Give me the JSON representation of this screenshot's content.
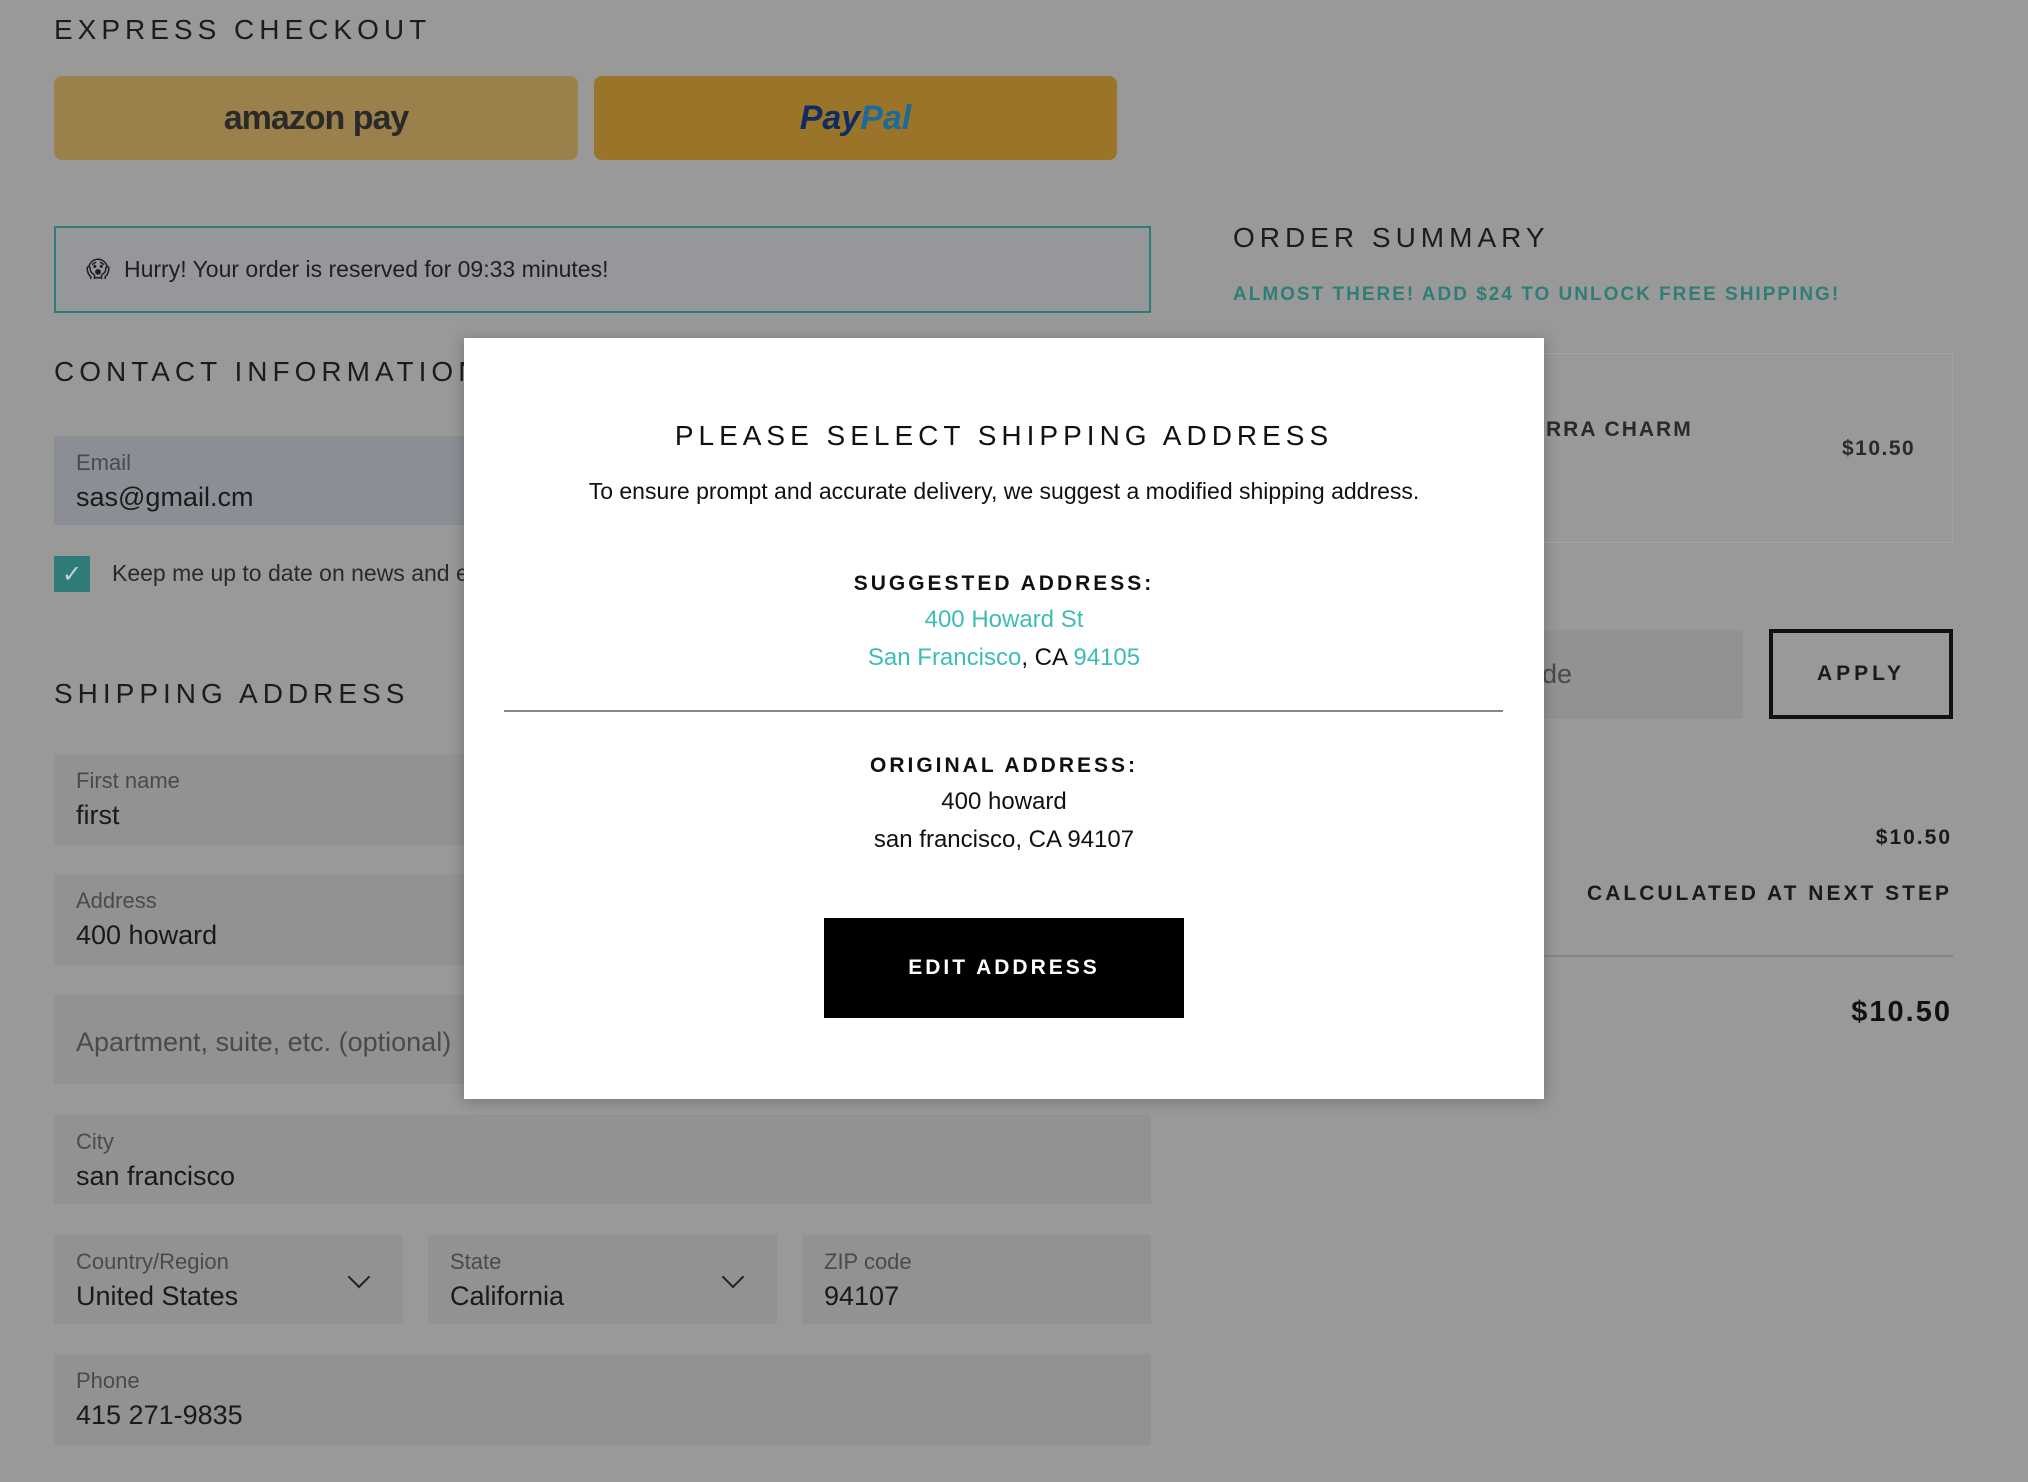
{
  "express": {
    "title": "EXPRESS CHECKOUT",
    "amazon_label": "amazon pay",
    "paypal_label_1": "Pay",
    "paypal_label_2": "Pal"
  },
  "timer": {
    "icon": "screaming-face-emoji",
    "text": "Hurry! Your order is reserved for 09:33 minutes!"
  },
  "contact": {
    "title": "CONTACT INFORMATION",
    "email_label": "Email",
    "email_value": "sas@gmail.cm",
    "newsletter_checked": true,
    "newsletter_label": "Keep me up to date on news and e"
  },
  "shipping": {
    "title": "SHIPPING ADDRESS",
    "first_name_label": "First name",
    "first_name_value": "first",
    "address_label": "Address",
    "address_value": "400 howard",
    "apt_placeholder": "Apartment, suite, etc. (optional)",
    "city_label": "City",
    "city_value": "san francisco",
    "country_label": "Country/Region",
    "country_value": "United States",
    "state_label": "State",
    "state_value": "California",
    "zip_label": "ZIP code",
    "zip_value": "94107",
    "phone_label": "Phone",
    "phone_value": "415 271-9835"
  },
  "summary": {
    "title": "ORDER SUMMARY",
    "free_shipping": "ALMOST THERE! ADD $24 TO UNLOCK FREE SHIPPING!",
    "product_name": "ERRA CHARM",
    "product_price": "$10.50",
    "discount_placeholder": "de",
    "apply_label": "APPLY",
    "subtotal": "$10.50",
    "shipping": "CALCULATED AT NEXT STEP",
    "total": "$10.50"
  },
  "modal": {
    "title": "PLEASE SELECT SHIPPING ADDRESS",
    "subtitle": "To ensure prompt and accurate delivery, we suggest a modified shipping address.",
    "suggested_label": "SUGGESTED ADDRESS:",
    "suggested_line1": "400 Howard St",
    "suggested_city": "San Francisco",
    "suggested_sep": ", CA ",
    "suggested_zip": "94105",
    "original_label": "ORIGINAL ADDRESS:",
    "original_line1": "400 howard",
    "original_line2": "san francisco, CA 94107",
    "edit_label": "EDIT ADDRESS"
  },
  "colors": {
    "accent": "#3dbdb6",
    "overlay_bg": "#999999",
    "teal_dim": "#2f7d78"
  }
}
